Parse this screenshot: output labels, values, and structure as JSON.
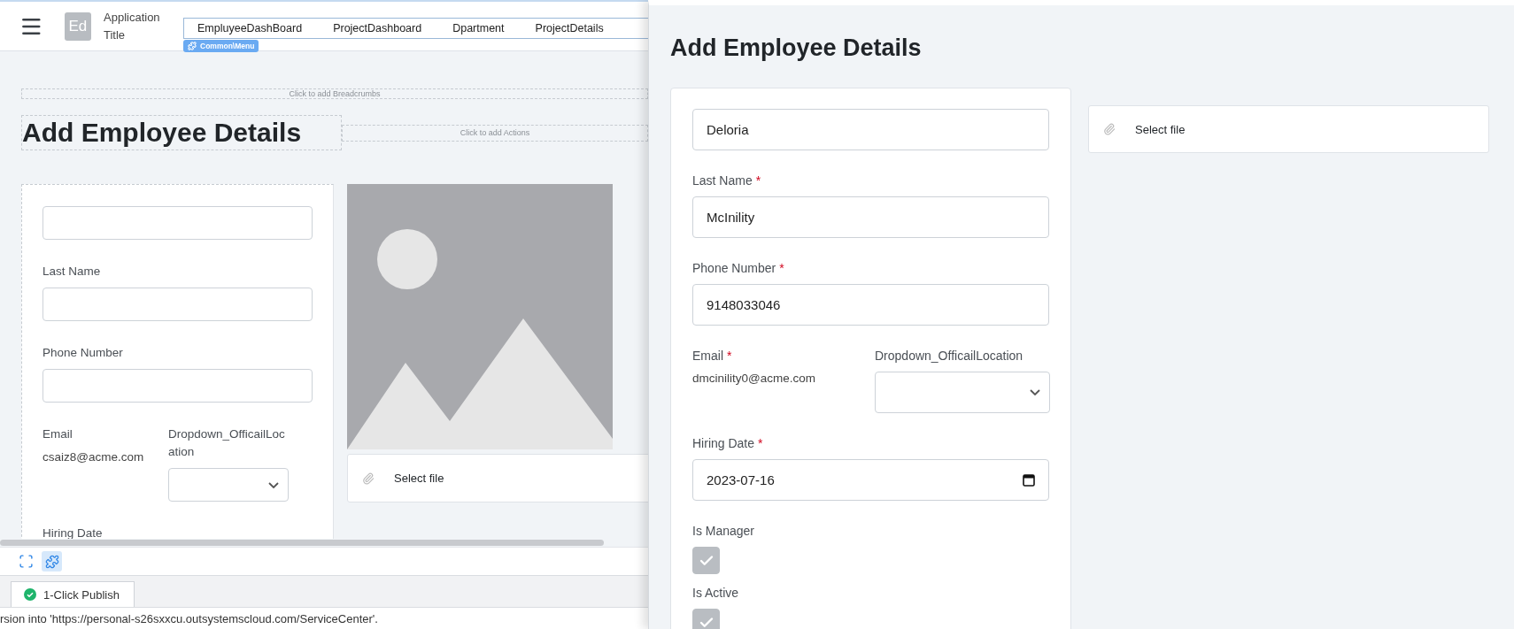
{
  "editor": {
    "header": {
      "avatar": "Ed",
      "app_title": "Application Title",
      "menu_items": [
        {
          "label": "EmpluyeeDashBoard"
        },
        {
          "label": "ProjectDashboard"
        },
        {
          "label": "Dpartment"
        },
        {
          "label": "ProjectDetails"
        }
      ],
      "menu_badge": "Common\\Menu"
    },
    "breadcrumbs_placeholder": "Click to add Breadcrumbs",
    "page_title": "Add Employee Details",
    "actions_placeholder": "Click to add Actions",
    "form": {
      "fields": [
        {
          "kind": "input"
        },
        {
          "kind": "input",
          "label": "Last Name"
        },
        {
          "kind": "input",
          "label": "Phone Number"
        },
        {
          "kind": "pair",
          "email": {
            "label": "Email",
            "value": "csaiz8@acme.com"
          },
          "dropdown": {
            "label": "Dropdown_OfficailLocation"
          }
        },
        {
          "kind": "label",
          "label": "Hiring Date"
        }
      ]
    },
    "file_upload": {
      "label": "Select file"
    },
    "toolbar": [
      {
        "kind": "fullscreen",
        "selected": false
      },
      {
        "kind": "widget",
        "selected": true
      }
    ],
    "tabs": [
      {
        "label": "1-Click Publish",
        "published": true,
        "selected": true
      }
    ],
    "status_message": "rsion into 'https://personal-s26sxxcu.outsystemscloud.com/ServiceCenter'."
  },
  "preview": {
    "page_title": "Add Employee Details",
    "form": {
      "fields": [
        {
          "kind": "input",
          "value": "Deloria"
        },
        {
          "kind": "input",
          "label": "Last Name",
          "required_mark": "*",
          "value": "McInility"
        },
        {
          "kind": "input",
          "label": "Phone Number",
          "required_mark": "*",
          "value": "9148033046"
        },
        {
          "kind": "pair",
          "email": {
            "label": "Email",
            "required_mark": "*",
            "value": "dmcinility0@acme.com"
          },
          "dropdown": {
            "label": "Dropdown_OfficailLocation"
          }
        },
        {
          "kind": "date",
          "label": "Hiring Date",
          "required_mark": "*",
          "value": "2023-07-16"
        },
        {
          "kind": "checkbox",
          "label": "Is Manager",
          "checked": true
        },
        {
          "kind": "checkbox",
          "label": "Is Active",
          "checked": true
        }
      ]
    },
    "file_upload": {
      "label": "Select file"
    }
  }
}
